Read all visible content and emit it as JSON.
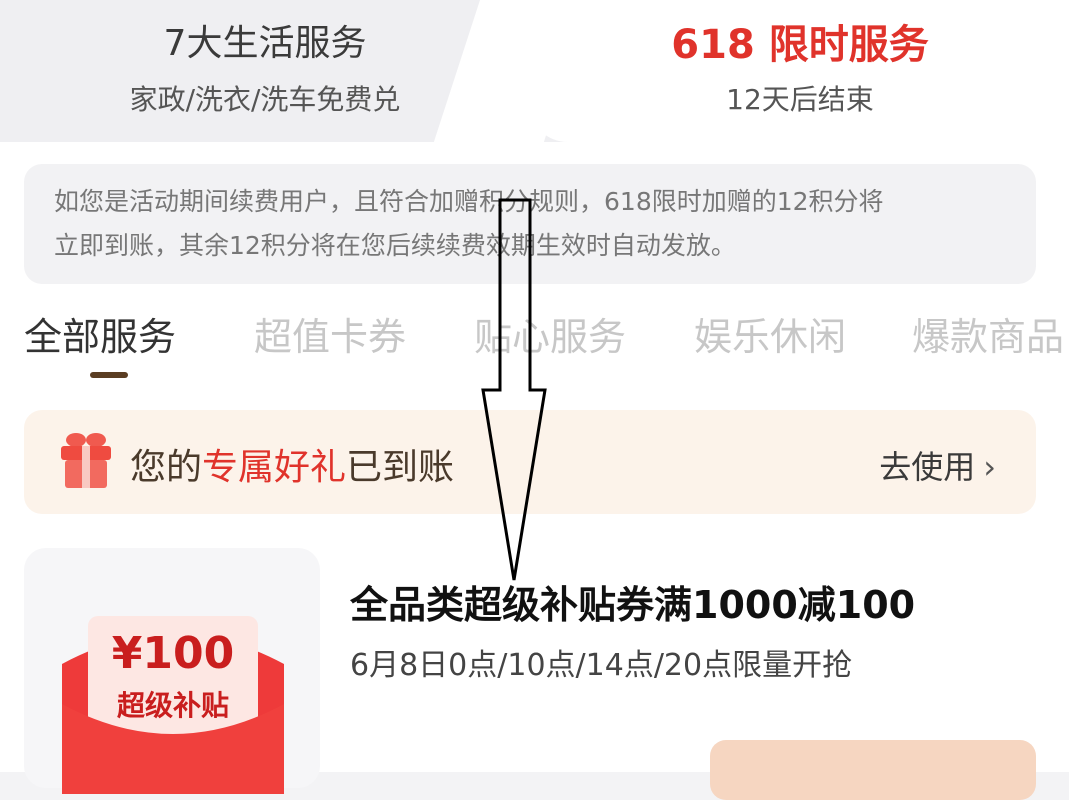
{
  "top": {
    "left_card": {
      "title": "7大生活服务",
      "subtitle": "家政/洗衣/洗车免费兑"
    },
    "right_card": {
      "title": "618 限时服务",
      "subtitle": "12天后结束"
    }
  },
  "notice": {
    "line1": "如您是活动期间续费用户，且符合加赠积分规则，618限时加赠的12积分将",
    "line2": "立即到账，其余12积分将在您后续续费效期生效时自动发放。"
  },
  "tabs": [
    {
      "label": "全部服务",
      "active": true
    },
    {
      "label": "超值卡券",
      "active": false
    },
    {
      "label": "贴心服务",
      "active": false
    },
    {
      "label": "娱乐休闲",
      "active": false
    },
    {
      "label": "爆款商品",
      "active": false
    }
  ],
  "gift_bar": {
    "text_before": "您的",
    "text_highlight": "专属好礼",
    "text_after": "已到账",
    "action_label": "去使用",
    "icon": "gift-icon"
  },
  "offer": {
    "coupon_amount": "¥100",
    "coupon_label": "超级补贴",
    "title": "全品类超级补贴券满1000减100",
    "subtitle": "6月8日0点/10点/14点/20点限量开抢"
  },
  "colors": {
    "accent_red": "#e0332b",
    "gift_bar_bg": "#fcf3ea",
    "tab_indicator": "#5a3d22",
    "detail_button_bg": "#f6d6c1"
  }
}
